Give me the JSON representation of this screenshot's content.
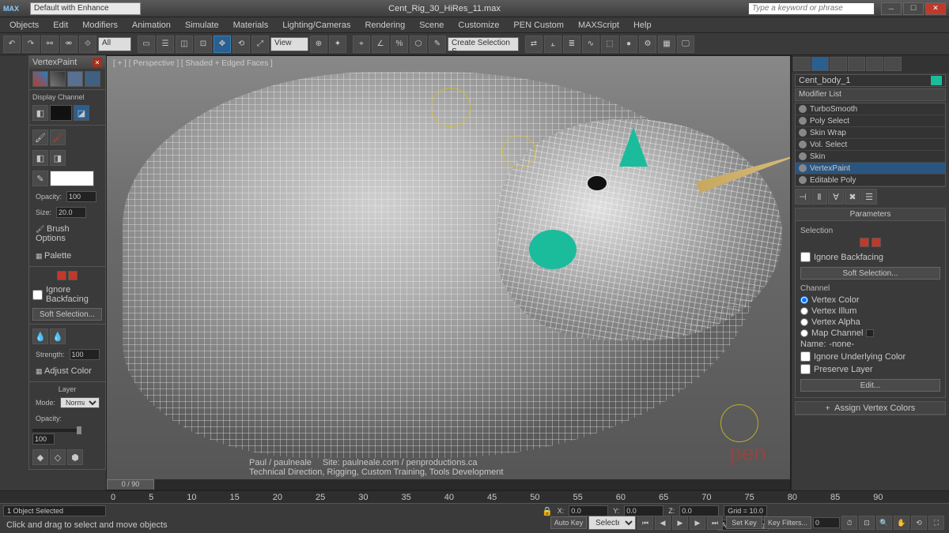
{
  "title": "Cent_Rig_30_HiRes_11.max",
  "search_placeholder": "Type a keyword or phrase",
  "doc_dropdown": "Default with Enhance",
  "menu": [
    "Objects",
    "Edit",
    "Modifiers",
    "Animation",
    "Simulate",
    "Materials",
    "Lighting/Cameras",
    "Rendering",
    "Scene",
    "Customize",
    "PEN Custom",
    "MAXScript",
    "Help"
  ],
  "toolbar_dd1": "All",
  "toolbar_dd2": "View",
  "toolbar_input1": "Create Selection S",
  "viewport_label": "[ + ] [ Perspective ] [ Shaded + Edged Faces ]",
  "time_pos": "0 / 90",
  "credit_site": "Site: paulneale.com / penproductions.ca",
  "credit_role": "Technical Direction, Rigging, Custom Training, Tools Development",
  "credit_name": "Paul / paulneale",
  "pen_logo": "pen",
  "timeline_ticks": [
    "0",
    "5",
    "10",
    "15",
    "20",
    "25",
    "30",
    "35",
    "40",
    "45",
    "50",
    "55",
    "60",
    "65",
    "70",
    "75",
    "80",
    "85",
    "90"
  ],
  "vpaint": {
    "title": "VertexPaint",
    "display_channel": "Display Channel",
    "opacity_lbl": "Opacity:",
    "opacity_val": "100",
    "size_lbl": "Size:",
    "size_val": "20.0",
    "brush_opts": "Brush Options",
    "palette": "Palette",
    "ignore_bf": "Ignore Backfacing",
    "soft_sel": "Soft Selection...",
    "strength_lbl": "Strength:",
    "strength_val": "100",
    "adjust_color": "Adjust Color",
    "layer": "Layer",
    "mode_lbl": "Mode:",
    "mode_val": "Normal",
    "opacity2_lbl": "Opacity:",
    "opacity2_val": "100"
  },
  "right": {
    "obj_name": "Cent_body_1",
    "mod_list_lbl": "Modifier List",
    "modifiers": [
      "TurboSmooth",
      "Poly Select",
      "Skin Wrap",
      "Vol. Select",
      "Skin",
      "VertexPaint",
      "Editable Poly"
    ],
    "mod_selected_index": 5,
    "params_head": "Parameters",
    "selection_lbl": "Selection",
    "ignore_bf": "Ignore Backfacing",
    "soft_sel": "Soft Selection...",
    "channel_lbl": "Channel",
    "radios": [
      "Vertex Color",
      "Vertex Illum",
      "Vertex Alpha",
      "Map Channel"
    ],
    "map_chan_val": "",
    "name_lbl": "Name:",
    "name_val": "-none-",
    "ignore_under": "Ignore Underlying Color",
    "preserve": "Preserve Layer",
    "edit_btn": "Edit...",
    "assign_btn": "Assign Vertex Colors"
  },
  "status": {
    "sel": "1 Object Selected",
    "prompt": "Click and drag to select and move objects",
    "x": "0.0",
    "y": "0.0",
    "z": "0.0",
    "grid": "Grid = 10.0",
    "add_time_tag": "Add Time Tag",
    "autokey": "Auto Key",
    "setkey": "Set Key",
    "selected": "Selected",
    "keyfilters": "Key Filters..."
  }
}
